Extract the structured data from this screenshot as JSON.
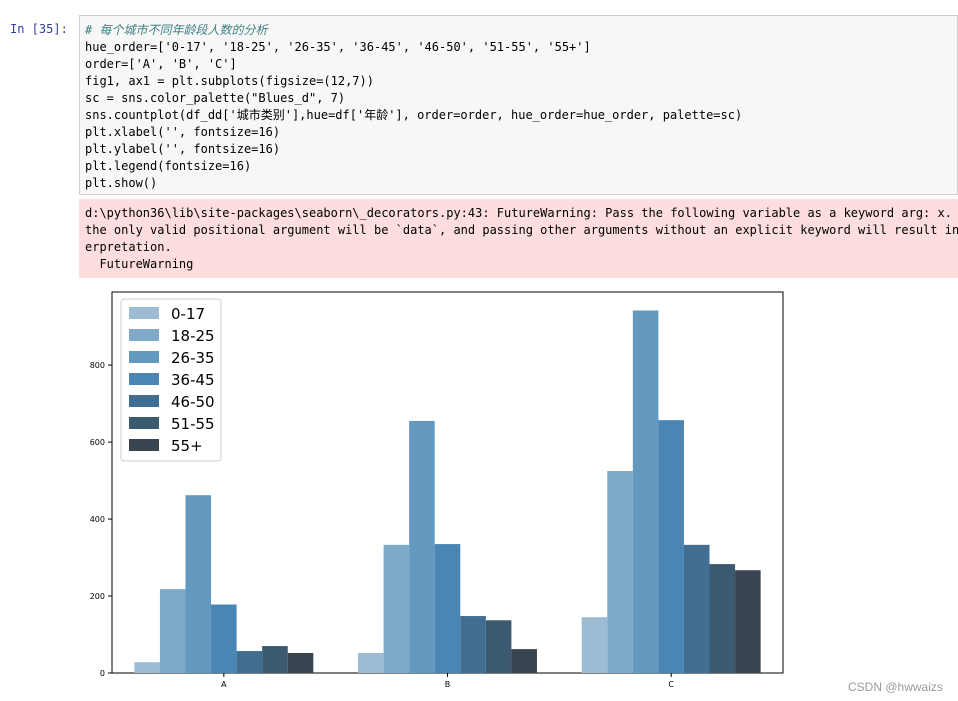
{
  "cell": {
    "prompt": "In  [35]:",
    "code_lines": [
      "# 每个城市不同年龄段人数的分析",
      "hue_order=['0-17', '18-25', '26-35', '36-45', '46-50', '51-55', '55+']",
      "order=['A', 'B', 'C']",
      "fig1, ax1 = plt.subplots(figsize=(12,7))",
      "sc = sns.color_palette(\"Blues_d\", 7)",
      "sns.countplot(df_dd['城市类别'],hue=df['年龄'], order=order, hue_order=hue_order, palette=sc)",
      "plt.xlabel('', fontsize=16)",
      "plt.ylabel('', fontsize=16)",
      "plt.legend(fontsize=16)",
      "plt.show()"
    ],
    "warning_lines": [
      "d:\\python36\\lib\\site-packages\\seaborn\\_decorators.py:43: FutureWarning: Pass the following variable as a keyword arg: x. From",
      "the only valid positional argument will be `data`, and passing other arguments without an explicit keyword will result in an",
      "erpretation.",
      "  FutureWarning"
    ]
  },
  "chart_data": {
    "type": "bar",
    "categories": [
      "A",
      "B",
      "C"
    ],
    "series": [
      {
        "name": "0-17",
        "values": [
          28,
          52,
          145
        ],
        "color": "#9dbcd4"
      },
      {
        "name": "18-25",
        "values": [
          218,
          333,
          525
        ],
        "color": "#7ea9c8"
      },
      {
        "name": "26-35",
        "values": [
          462,
          655,
          942
        ],
        "color": "#6399be"
      },
      {
        "name": "36-45",
        "values": [
          178,
          335,
          657
        ],
        "color": "#4a86b4"
      },
      {
        "name": "46-50",
        "values": [
          57,
          148,
          333
        ],
        "color": "#426f91"
      },
      {
        "name": "51-55",
        "values": [
          70,
          137,
          283
        ],
        "color": "#3b5a70"
      },
      {
        "name": "55+",
        "values": [
          52,
          62,
          267
        ],
        "color": "#38444f"
      }
    ],
    "yticks": [
      0,
      200,
      400,
      600,
      800
    ],
    "ylim": [
      0,
      990
    ],
    "xlabel": "",
    "ylabel": "",
    "legend_position": "upper-left"
  },
  "watermark": "CSDN @hwwaizs"
}
